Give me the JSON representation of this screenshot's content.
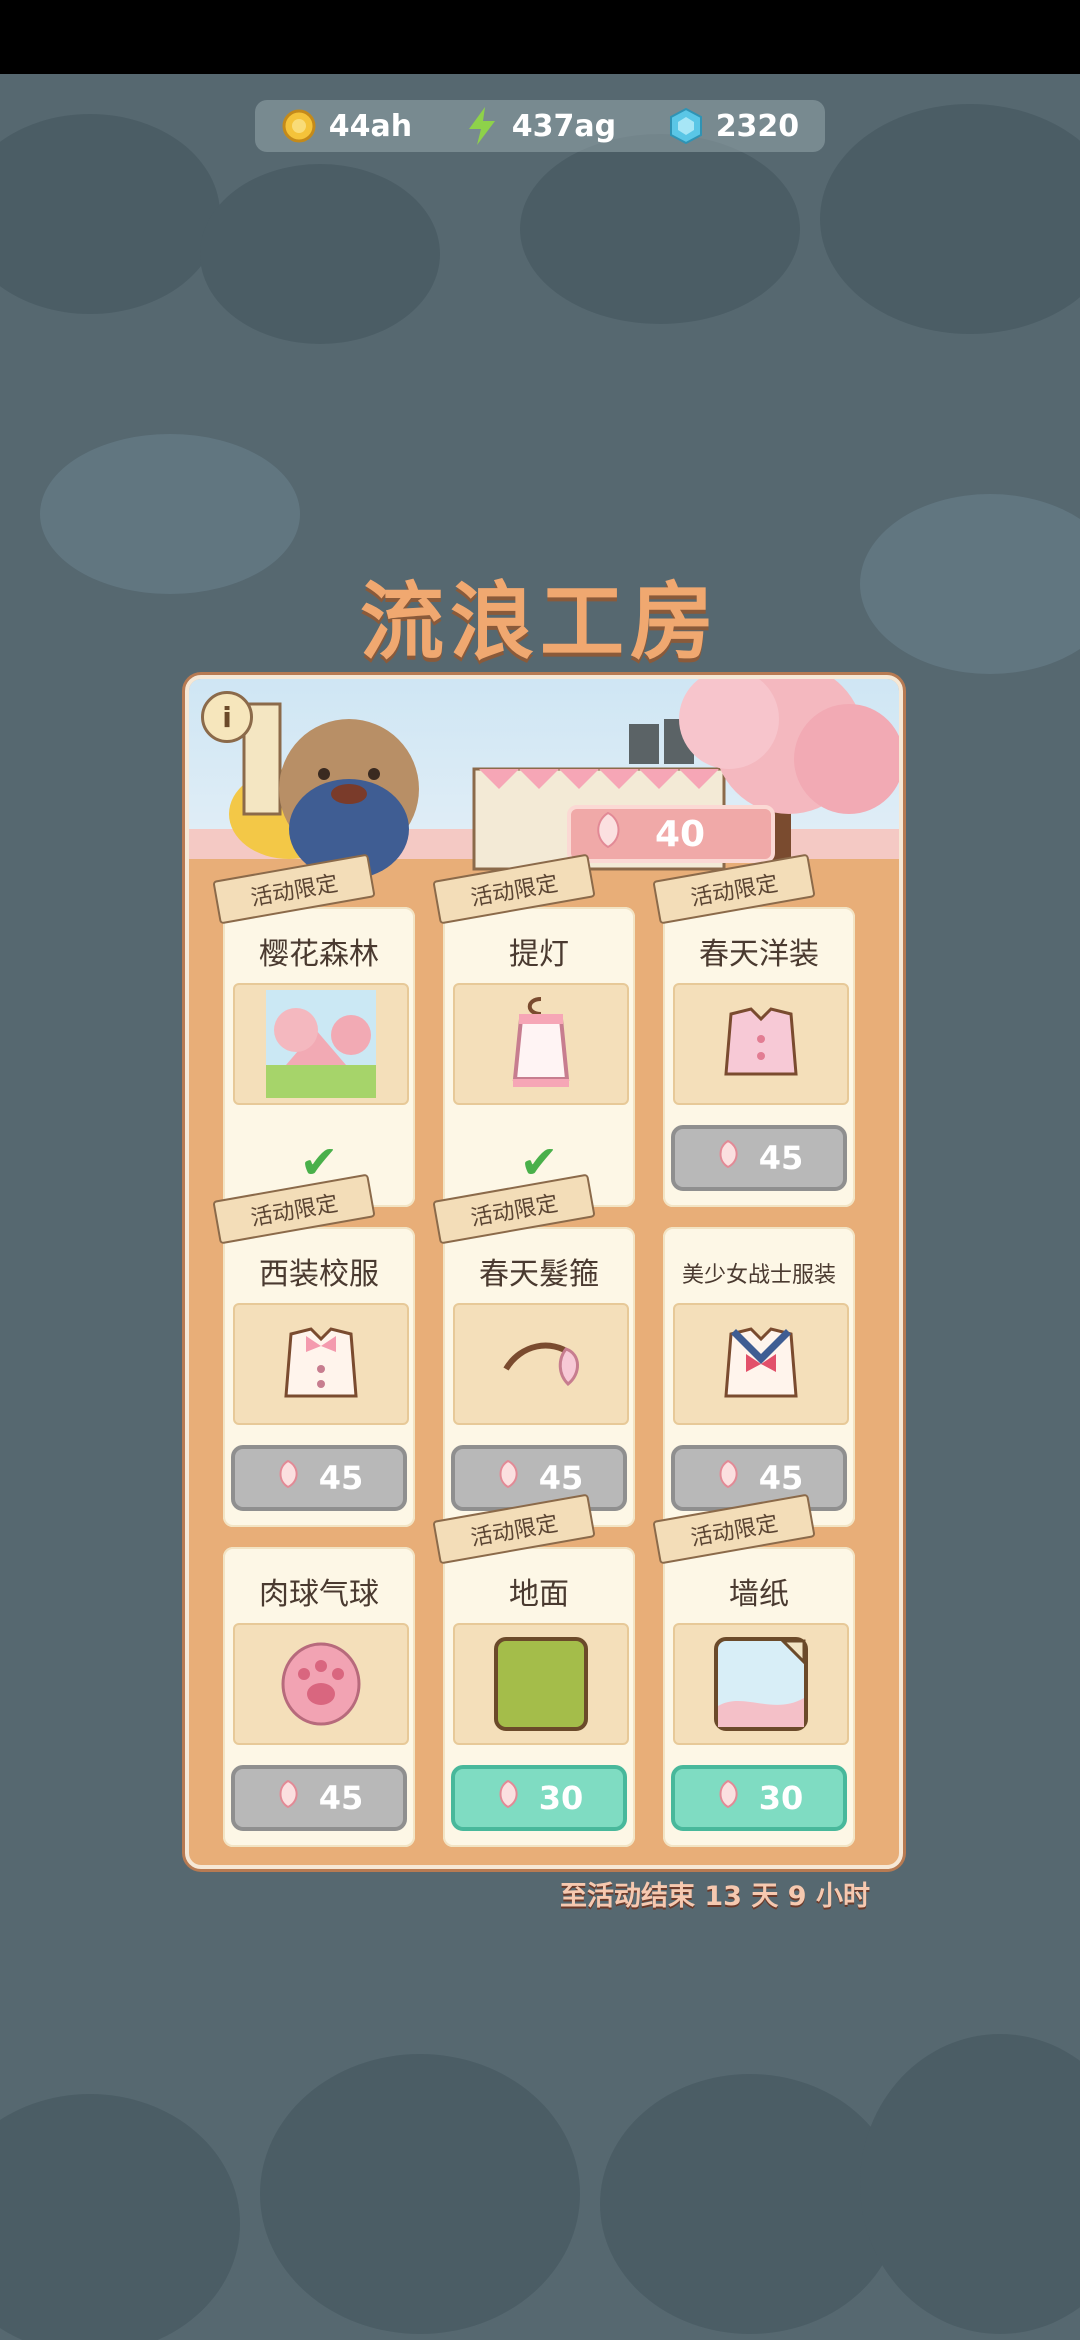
{
  "resources": [
    {
      "icon": "coin-icon",
      "value": "44ah",
      "color": "#f4c33a"
    },
    {
      "icon": "lightning-icon",
      "value": "437ag",
      "color": "#8ed24a"
    },
    {
      "icon": "gem-icon",
      "value": "2320",
      "color": "#5ac6e6"
    }
  ],
  "title": "流浪工房",
  "petal_count": "40",
  "limited_label": "活动限定",
  "items": [
    {
      "name": "樱花森林",
      "owned": true,
      "thumb": "sakura-forest-icon"
    },
    {
      "name": "提灯",
      "owned": true,
      "thumb": "lantern-icon"
    },
    {
      "name": "春天洋装",
      "owned": false,
      "price": "45",
      "style": "gray",
      "thumb": "spring-dress-icon"
    },
    {
      "name": "西装校服",
      "owned": false,
      "price": "45",
      "style": "gray",
      "thumb": "school-uniform-icon"
    },
    {
      "name": "春天髮箍",
      "owned": false,
      "price": "45",
      "style": "gray",
      "thumb": "headband-icon"
    },
    {
      "name": "美少女战士服装",
      "owned": false,
      "price": "45",
      "style": "gray",
      "thumb": "sailor-outfit-icon"
    },
    {
      "name": "肉球气球",
      "owned": false,
      "price": "45",
      "style": "gray",
      "thumb": "paw-balloon-icon"
    },
    {
      "name": "地面",
      "owned": false,
      "price": "30",
      "style": "teal",
      "thumb": "floor-icon"
    },
    {
      "name": "墙纸",
      "owned": false,
      "price": "30",
      "style": "teal",
      "thumb": "wallpaper-icon"
    }
  ],
  "countdown": "至活动结束  13 天 9 小时"
}
